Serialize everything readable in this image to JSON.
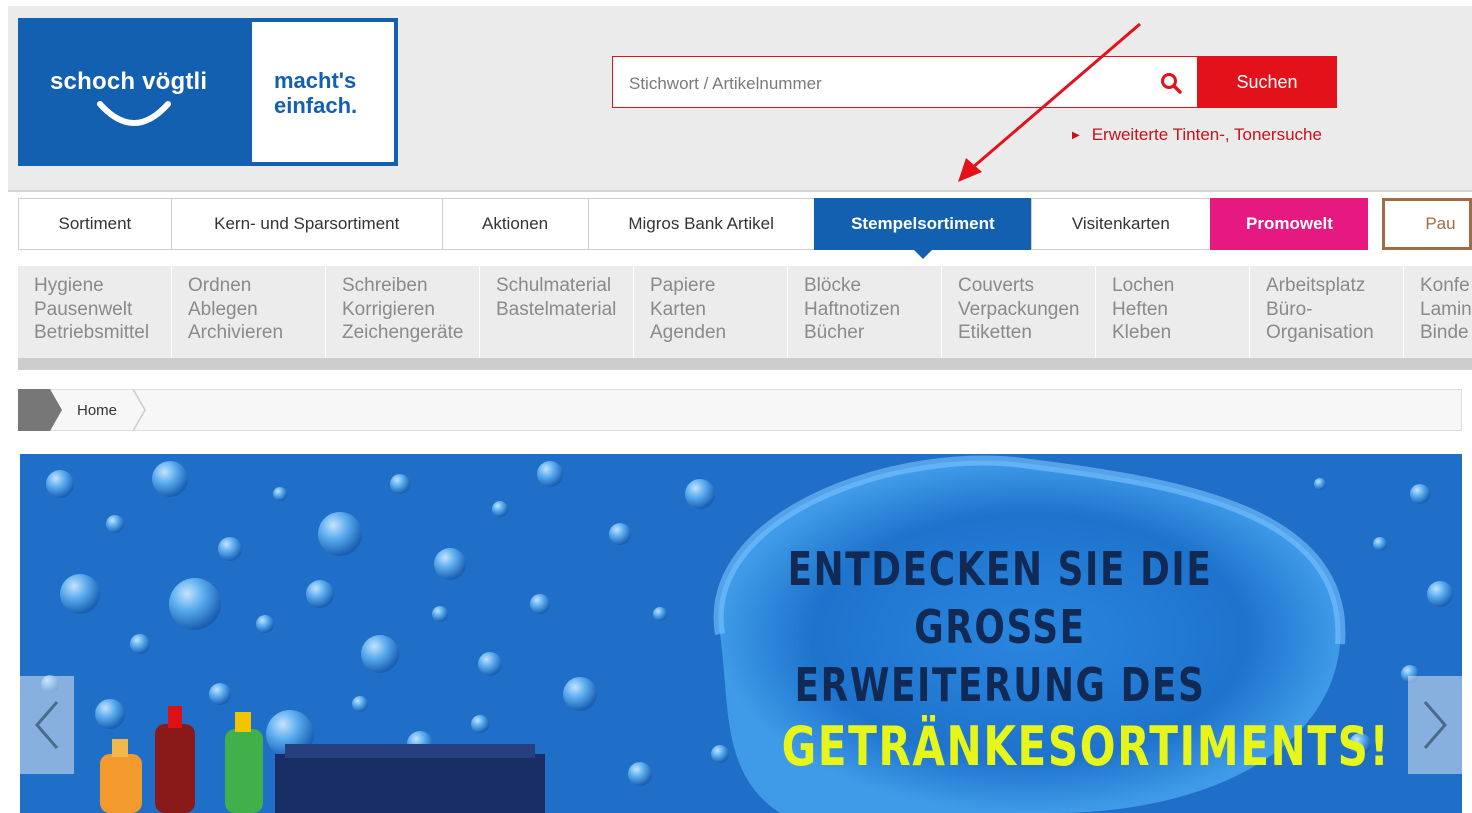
{
  "brand": {
    "name": "schoch vögtli",
    "slogan": "macht's einfach.",
    "slogan_line1": "macht's",
    "slogan_line2": "einfach.",
    "colors": {
      "primary": "#1460b0",
      "accent_red": "#e3111a",
      "promo_pink": "#e5197f",
      "pause_brown": "#a06b45"
    }
  },
  "search": {
    "placeholder": "Stichwort / Artikelnummer",
    "value": "",
    "button_label": "Suchen",
    "extended_link": "Erweiterte Tinten-, Tonersuche",
    "icon": "search-icon"
  },
  "nav": {
    "tabs": [
      {
        "label": "Sortiment",
        "state": "normal"
      },
      {
        "label": "Kern- und Sparsortiment",
        "state": "normal"
      },
      {
        "label": "Aktionen",
        "state": "normal"
      },
      {
        "label": "Migros Bank Artikel",
        "state": "normal"
      },
      {
        "label": "Stempelsortiment",
        "state": "active"
      },
      {
        "label": "Visitenkarten",
        "state": "normal"
      },
      {
        "label": "Promowelt",
        "state": "promo"
      },
      {
        "label": "Pau",
        "state": "pause"
      }
    ]
  },
  "subnav": {
    "columns": [
      [
        "Hygiene",
        "Pausenwelt",
        "Betriebsmittel"
      ],
      [
        "Ordnen",
        "Ablegen",
        "Archivieren"
      ],
      [
        "Schreiben",
        "Korrigieren",
        "Zeichengeräte"
      ],
      [
        "Schulmaterial",
        "Bastelmaterial"
      ],
      [
        "Papiere",
        "Karten",
        "Agenden"
      ],
      [
        "Blöcke",
        "Haftnotizen",
        "Bücher"
      ],
      [
        "Couverts",
        "Verpackungen",
        "Etiketten"
      ],
      [
        "Lochen",
        "Heften",
        "Kleben"
      ],
      [
        "Arbeitsplatz",
        "Büro-",
        "Organisation"
      ],
      [
        "Konfe",
        "Lamin",
        "Binde"
      ]
    ]
  },
  "breadcrumb": {
    "home_label": "Home"
  },
  "banner": {
    "headline_line1": "ENTDECKEN SIE DIE",
    "headline_line2": "GROSSE ERWEITERUNG DES",
    "headline_line3": "GETRÄNKESORTIMENTS!",
    "prev_icon": "chevron-left-icon",
    "next_icon": "chevron-right-icon",
    "colors": {
      "background": "#1f6fc8",
      "headline_dark": "#112a55",
      "headline_highlight": "#e6f51a"
    }
  }
}
